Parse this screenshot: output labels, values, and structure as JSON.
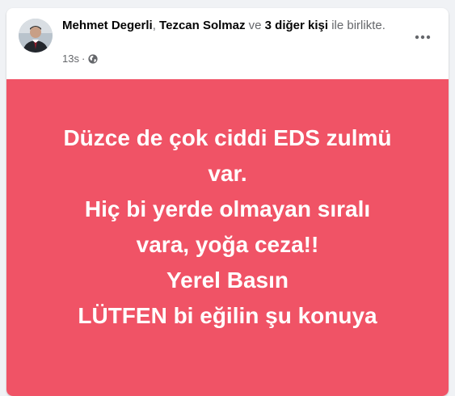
{
  "post": {
    "authors": {
      "author_1": "Mehmet Degerli",
      "comma": ", ",
      "author_2": "Tezcan Solmaz",
      "conj": " ve ",
      "others": "3 diğer kişi",
      "suffix": " ile birlikte."
    },
    "timestamp": "13s",
    "separator": "·",
    "audience_icon": "globe-icon",
    "menu_icon": "more-horizontal-icon",
    "background_color": "#f05366",
    "text_lines": [
      "Düzce de çok ciddi EDS zulmü",
      "var.",
      "Hiç bi yerde olmayan sıralı",
      "vara, yoğa ceza!!",
      "Yerel Basın",
      "LÜTFEN bi eğilin şu konuya"
    ]
  }
}
